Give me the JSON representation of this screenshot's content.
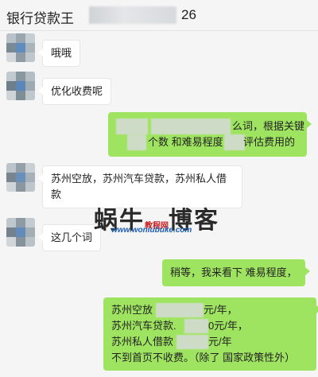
{
  "header": {
    "title_prefix": "银行贷款王",
    "title_suffix": "26"
  },
  "messages": [
    {
      "side": "in",
      "lines": [
        "哦哦"
      ]
    },
    {
      "side": "in",
      "lines": [
        "优化收费呢"
      ]
    },
    {
      "side": "out",
      "lines": [
        "么词，根据关键",
        "个数 和难易程度",
        "评估费用的"
      ]
    },
    {
      "side": "in",
      "lines": [
        "苏州空放，苏州汽车贷款，苏州私人借",
        "款"
      ]
    },
    {
      "side": "in",
      "lines": [
        "这几个词"
      ]
    },
    {
      "side": "out",
      "lines": [
        "稍等，我来看下 难易程度，"
      ]
    },
    {
      "side": "out",
      "lines": [
        "苏州空放",
        "元/年，",
        "苏州汽车贷款.",
        "0元/年，",
        "苏州私人借款",
        "元/年",
        "不到首页不收费。（除了 国家政策性外）"
      ]
    }
  ],
  "watermark": {
    "brand": "蜗牛",
    "sub": "教程网",
    "brand2": "博客",
    "url": "www.woniubuke.com"
  },
  "colors": {
    "outgoing_bubble": "#9fe461",
    "incoming_bubble": "#ffffff",
    "background": "#f5f5f5"
  }
}
